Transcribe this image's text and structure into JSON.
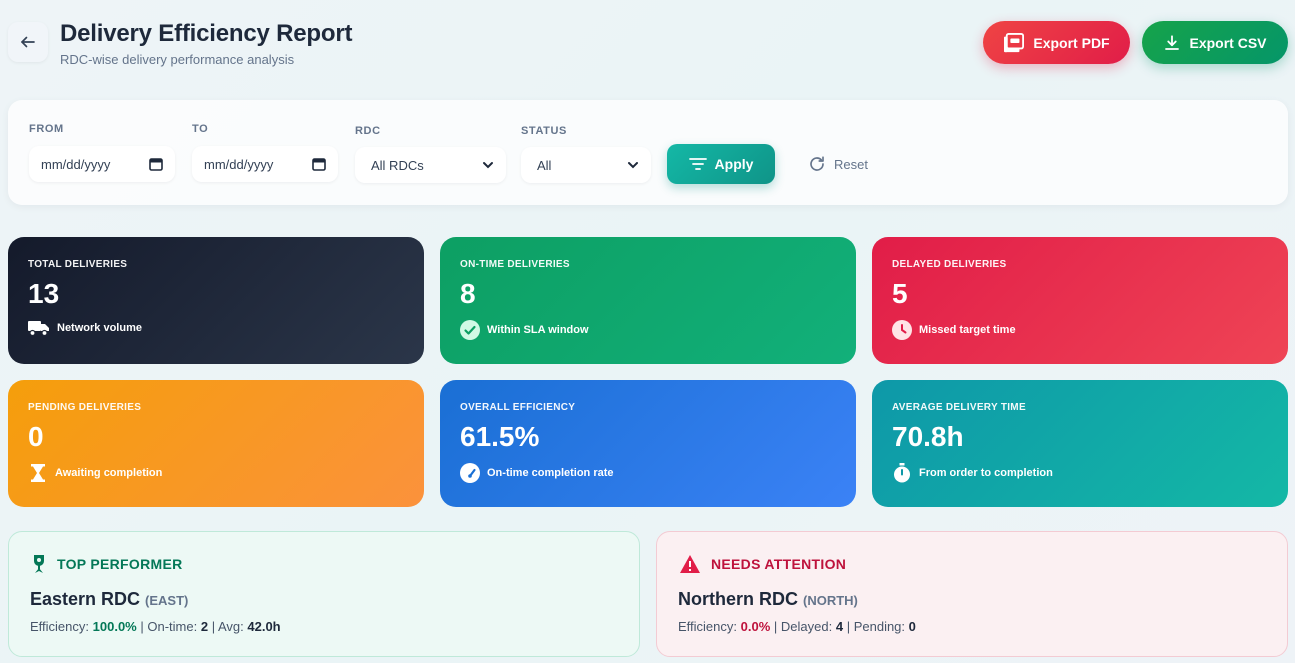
{
  "header": {
    "title": "Delivery Efficiency Report",
    "subtitle": "RDC-wise delivery performance analysis",
    "export_pdf": "Export PDF",
    "export_csv": "Export CSV"
  },
  "filters": {
    "from_label": "FROM",
    "from_value": "mm/dd/yyyy",
    "to_label": "TO",
    "to_value": "mm/dd/yyyy",
    "rdc_label": "RDC",
    "rdc_value": "All RDCs",
    "status_label": "STATUS",
    "status_value": "All",
    "apply": "Apply",
    "reset": "Reset"
  },
  "cards": {
    "total": {
      "label": "TOTAL DELIVERIES",
      "value": "13",
      "note": "Network volume"
    },
    "ontime": {
      "label": "ON-TIME DELIVERIES",
      "value": "8",
      "note": "Within SLA window"
    },
    "delayed": {
      "label": "DELAYED DELIVERIES",
      "value": "5",
      "note": "Missed target time"
    },
    "pending": {
      "label": "PENDING DELIVERIES",
      "value": "0",
      "note": "Awaiting completion"
    },
    "efficiency": {
      "label": "OVERALL EFFICIENCY",
      "value": "61.5%",
      "note": "On-time completion rate"
    },
    "avg_time": {
      "label": "AVERAGE DELIVERY TIME",
      "value": "70.8h",
      "note": "From order to completion"
    }
  },
  "top_performer": {
    "heading": "TOP PERFORMER",
    "name": "Eastern RDC",
    "code": "(EAST)",
    "eff_label": "Efficiency:",
    "eff_value": "100.0%",
    "ontime_label": "On-time:",
    "ontime_value": "2",
    "avg_label": "Avg:",
    "avg_value": "42.0h"
  },
  "needs_attention": {
    "heading": "NEEDS ATTENTION",
    "name": "Northern RDC",
    "code": "(NORTH)",
    "eff_label": "Efficiency:",
    "eff_value": "0.0%",
    "delayed_label": "Delayed:",
    "delayed_value": "4",
    "pending_label": "Pending:",
    "pending_value": "0"
  },
  "colors": {
    "success": "#047857",
    "danger": "#be123c",
    "teal": "#0f9488"
  }
}
